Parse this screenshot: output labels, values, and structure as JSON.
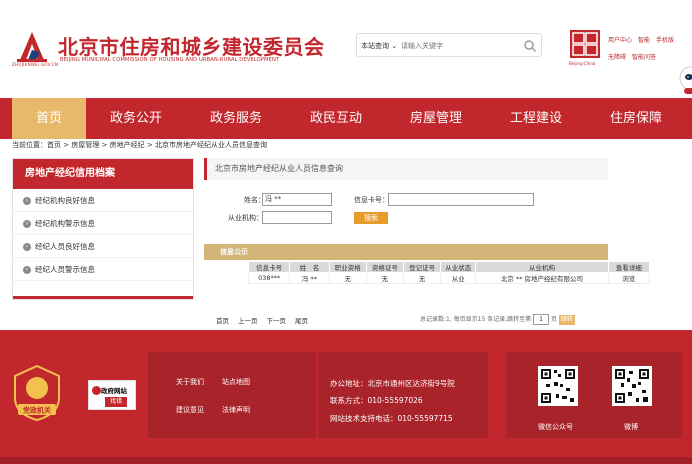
{
  "header": {
    "logo_sub": "ZHUJIANWEI.GOV.CN",
    "title": "北京市住房和城乡建设委员会",
    "subtitle": "BEIJING MUNICIPAL COMMISSION OF HOUSING AND URBAN-RURAL DEVELOPMENT",
    "search_scope": "本站查询 ⌄",
    "search_placeholder": "请输入关键字",
    "capital_text": "Beijing·China",
    "links": [
      "用户中心",
      "智能",
      "手机版",
      "无障碍",
      "智能问答"
    ]
  },
  "nav": {
    "items": [
      {
        "label": "首页",
        "active": true
      },
      {
        "label": "政务公开",
        "active": false
      },
      {
        "label": "政务服务",
        "active": false
      },
      {
        "label": "政民互动",
        "active": false
      },
      {
        "label": "房屋管理",
        "active": false
      },
      {
        "label": "工程建设",
        "active": false
      },
      {
        "label": "住房保障",
        "active": false
      }
    ]
  },
  "breadcrumb": "当前位置：首页 > 房屋管理 > 房地产经纪 > 北京市房地产经纪从业人员信息查询",
  "sidebar": {
    "title": "房地产经纪信用档案",
    "items": [
      {
        "label": "经纪机构良好信息"
      },
      {
        "label": "经纪机构警示信息"
      },
      {
        "label": "经纪人员良好信息"
      },
      {
        "label": "经纪人员警示信息"
      }
    ]
  },
  "query": {
    "title": "北京市房地产经纪从业人员信息查询",
    "name_label": "姓名：",
    "name_value": "冯 **",
    "cert_label": "信息卡号：",
    "cert_value": "",
    "org_label": "从业机构：",
    "org_value": "",
    "search_button": "搜索"
  },
  "results": {
    "heading": "信息公示",
    "columns": [
      "信息卡号",
      "姓　名",
      "职业资格",
      "资格证号",
      "登记证号",
      "从业状态",
      "从业机构",
      "查看详细"
    ],
    "rows": [
      [
        "038***",
        "冯 **",
        "无",
        "无",
        "无",
        "从业",
        "北京 ** 房地产经纪有限公司",
        "浏览"
      ]
    ]
  },
  "pager": {
    "links": [
      "首页",
      "上一页",
      "下一页",
      "尾页"
    ],
    "summary": "总记录数:1, 每页显示15 条记录,跳转至第",
    "page_value": "1",
    "page_unit": "页",
    "go_label": "跳转"
  },
  "footer": {
    "party_label": "党政机关",
    "gov_badge_top": "政府网站",
    "gov_badge_bottom": "找错",
    "links_row1": [
      "关于我们",
      "站点地图"
    ],
    "links_row2": [
      "建议意见",
      "法律声明"
    ],
    "address": "办公地址：北京市通州区达济街9号院",
    "phone": "联系方式：010-55597026",
    "tech_phone": "网站技术支持电话：010-55597715",
    "qr_labels": [
      "微信公众号",
      "微博"
    ]
  },
  "colors": {
    "brand_red": "#c1272d",
    "nav_active": "#e8b96a",
    "results_band": "#d4b478",
    "search_btn": "#e89c2b"
  }
}
